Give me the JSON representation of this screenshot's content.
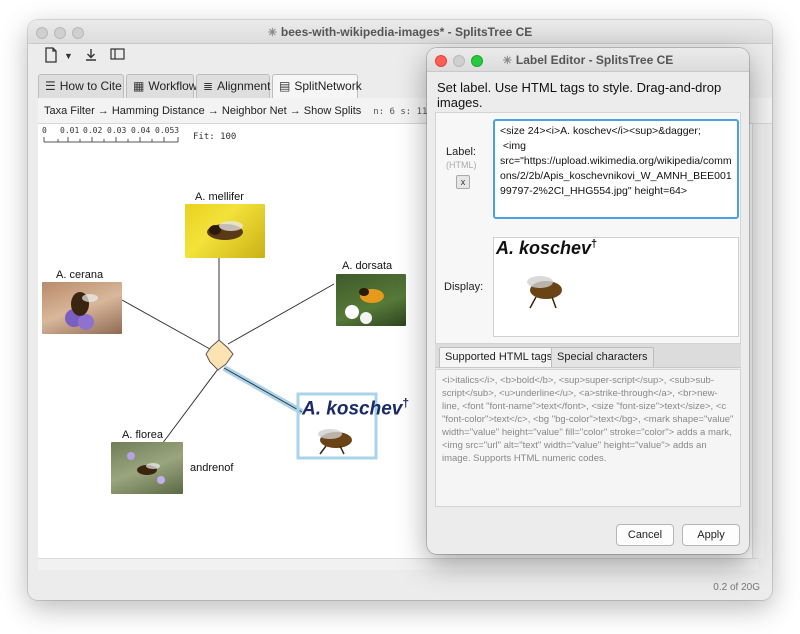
{
  "main_window": {
    "title": "bees-with-wikipedia-images* - SplitsTree CE",
    "tabs": [
      {
        "label": "How to Cite",
        "icon": "list-icon"
      },
      {
        "label": "Workflow",
        "icon": "workflow-icon"
      },
      {
        "label": "Alignment",
        "icon": "alignment-icon"
      },
      {
        "label": "SplitNetwork",
        "icon": "network-icon"
      }
    ],
    "breadcrumb": "Taxa Filter → Hamming Distance → Neighbor Net → Show Splits",
    "stats": "n: 6  s: 11",
    "ruler": {
      "ticks": [
        "0",
        "0.01",
        "0.02",
        "0.03",
        "0.04",
        "0.053"
      ],
      "fit": "Fit: 100"
    },
    "taxa": {
      "mellifer": "A. mellifer",
      "cerana": "A. cerana",
      "dorsata": "A. dorsata",
      "florea": "A. florea",
      "andrenof": "andrenof",
      "koschev": "A. koschev",
      "dagger": "†"
    },
    "status": "0.2 of 20G"
  },
  "label_editor": {
    "title": "Label Editor - SplitsTree CE",
    "instructions": "Set label. Use HTML tags to style. Drag-and-drop images.",
    "label_caption": "Label:",
    "html_hint": "(HTML)",
    "clear_label": "x",
    "label_value": "<size 24><i>A. koschev</i><sup>&dagger;\n <img\nsrc=\"https://upload.wikimedia.org/wikipedia/commons/2/2b/Apis_koschevnikovi_W_AMNH_BEE00199797-2%2CI_HHG554.jpg\" height=64>",
    "display_caption": "Display:",
    "display_title": "A. koschev",
    "display_dagger": "†",
    "help_tabs": [
      "Supported HTML tags",
      "Special characters"
    ],
    "help_text": "<i>italics</i>, <b>bold</b>, <sup>super-script</sup>, <sub>sub-script</sub>, <u>underline</u>, <a>strike-through</a>, <br>new-line, <font \"font-name\">text</font>, <size \"font-size\">text</size>, <c \"font-color\">text</c>, <bg \"bg-color\">text</bg>, <mark shape=\"value\" width=\"value\" height=\"value\" fill=\"color\" stroke=\"color\"> adds a mark, <img src=\"url\" alt=\"text\" width=\"value\" height=\"value\"> adds an image. Supports HTML numeric codes.",
    "cancel_label": "Cancel",
    "apply_label": "Apply"
  },
  "colors": {
    "accent": "#4aa3df",
    "node_fill": "#fde3b2",
    "selected_edge": "#a9d3ea"
  }
}
